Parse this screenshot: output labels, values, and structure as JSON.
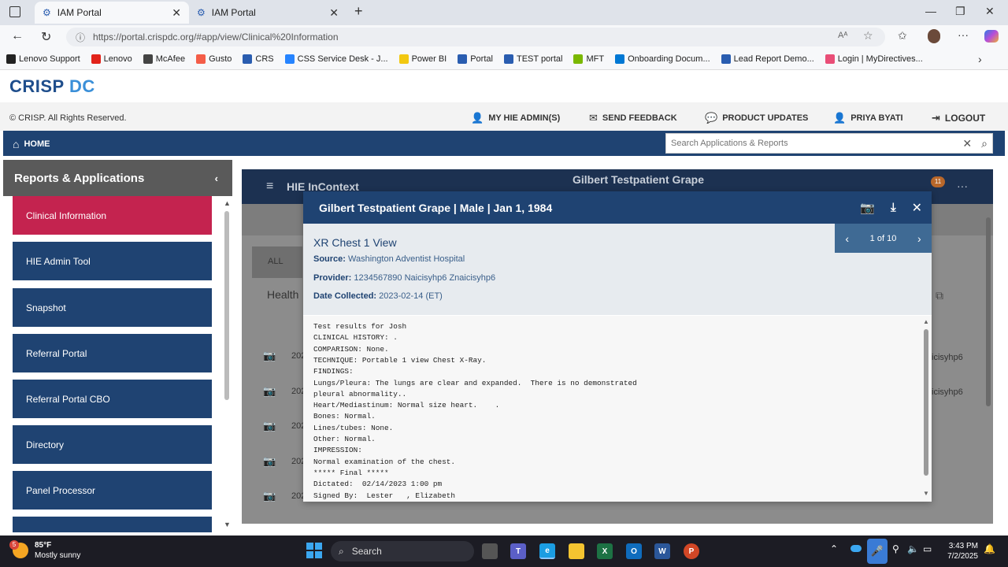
{
  "browser": {
    "tabs": [
      {
        "label": "IAM Portal",
        "active": true
      },
      {
        "label": "IAM Portal",
        "active": false
      }
    ],
    "url": "https://portal.crispdc.org/#app/view/Clinical%20Information",
    "bookmarks": [
      {
        "label": "Lenovo Support",
        "color": "#222222"
      },
      {
        "label": "Lenovo",
        "color": "#e2231a"
      },
      {
        "label": "McAfee",
        "color": "#444444"
      },
      {
        "label": "Gusto",
        "color": "#f45d48"
      },
      {
        "label": "CRS",
        "color": "#2a5db0"
      },
      {
        "label": "CSS Service Desk - J...",
        "color": "#2684ff"
      },
      {
        "label": "Power BI",
        "color": "#f2c811"
      },
      {
        "label": "Portal",
        "color": "#2a5db0"
      },
      {
        "label": "TEST portal",
        "color": "#2a5db0"
      },
      {
        "label": "MFT",
        "color": "#7ab800"
      },
      {
        "label": "Onboarding Docum...",
        "color": "#0078d4"
      },
      {
        "label": "Lead Report Demo...",
        "color": "#2a5db0"
      },
      {
        "label": "Login | MyDirectives...",
        "color": "#e94e77"
      }
    ]
  },
  "app": {
    "logo_main": "CRISP",
    "logo_accent": "DC",
    "copyright": "© CRISP. All Rights Reserved.",
    "header_links": [
      "MY HIE ADMIN(S)",
      "SEND FEEDBACK",
      "PRODUCT UPDATES",
      "PRIYA BYATI",
      "LOGOUT"
    ],
    "home": "HOME",
    "search_placeholder": "Search Applications & Reports"
  },
  "sidebar": {
    "title": "Reports & Applications",
    "items": [
      {
        "label": "Clinical Information",
        "active": true
      },
      {
        "label": "HIE Admin Tool"
      },
      {
        "label": "Snapshot"
      },
      {
        "label": "Referral Portal"
      },
      {
        "label": "Referral Portal CBO"
      },
      {
        "label": "Directory"
      },
      {
        "label": "Panel Processor"
      }
    ]
  },
  "background_panel": {
    "title": "HIE InContext",
    "patient": "Gilbert Testpatient Grape",
    "badge": "11",
    "tab_all": "ALL",
    "section": "Health",
    "row_prefix": "202",
    "row_suffix": "icisyhp6"
  },
  "modal": {
    "header": "Gilbert Testpatient Grape | Male | Jan 1, 1984",
    "pager": "1 of 10",
    "doc_title": "XR Chest 1 View",
    "source_label": "Source:",
    "source": "Washington Adventist Hospital",
    "provider_label": "Provider:",
    "provider": "1234567890 Naicisyhp6 Znaicisyhp6",
    "date_label": "Date Collected:",
    "date": "2023-02-14 (ET)",
    "report_lines": [
      "Test results for Josh",
      "CLINICAL HISTORY: .",
      "COMPARISON: None.",
      "TECHNIQUE: Portable 1 view Chest X-Ray.",
      "FINDINGS:",
      "Lungs/Pleura: The lungs are clear and expanded.  There is no demonstrated",
      "pleural abnormality..",
      "Heart/Mediastinum: Normal size heart.    .",
      "Bones: Normal.",
      "Lines/tubes: None.",
      "Other: Normal.",
      "IMPRESSION:",
      "Normal examination of the chest.",
      "***** Final *****",
      "Dictated:  02/14/2023 1:00 pm",
      "Signed By:  Lester   , Elizabeth"
    ]
  },
  "taskbar": {
    "temperature": "85°F",
    "weather": "Mostly sunny",
    "weather_badge": "5",
    "search": "Search",
    "time": "3:43 PM",
    "date": "7/2/2025"
  }
}
